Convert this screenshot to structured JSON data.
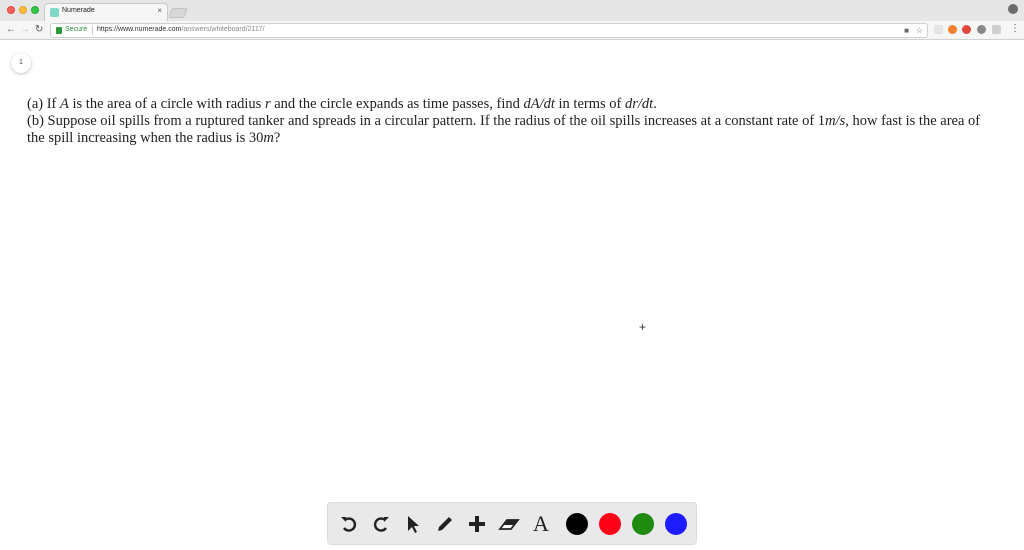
{
  "browser": {
    "tab_title": "Numerade",
    "tab_close": "×",
    "secure_label": "Secure",
    "url_host": "https://www.numerade.com",
    "url_path": "/answers/whiteboard/2117/"
  },
  "page": {
    "page_number": "1",
    "question": {
      "a_prefix": "(a) If ",
      "a_var_A": "A",
      "a_mid1": " is the area of a circle with radius ",
      "a_var_r": "r",
      "a_mid2": " and the circle expands as time passes, find ",
      "a_dAdt": "dA/dt",
      "a_mid3": " in terms of ",
      "a_drdt": "dr/dt",
      "a_end": ".",
      "b_line1_pre": "(b) Suppose oil spills from a ruptured tanker and spreads in a circular pattern. If the radius of the oil spills increases at a constant rate of 1",
      "b_unit_ms": "m/s",
      "b_line1_post": ", how fast is the area of",
      "b_line2_pre": "the spill increasing when the radius is 30",
      "b_unit_m": "m",
      "b_line2_post": "?"
    }
  },
  "whiteboard": {
    "tools": [
      "undo-icon",
      "redo-icon",
      "pointer-icon",
      "pencil-icon",
      "add-icon",
      "eraser-icon",
      "text-icon"
    ],
    "text_tool_glyph": "A",
    "colors": [
      "#000000",
      "#ff0019",
      "#1e8a0f",
      "#1c1cff"
    ]
  }
}
